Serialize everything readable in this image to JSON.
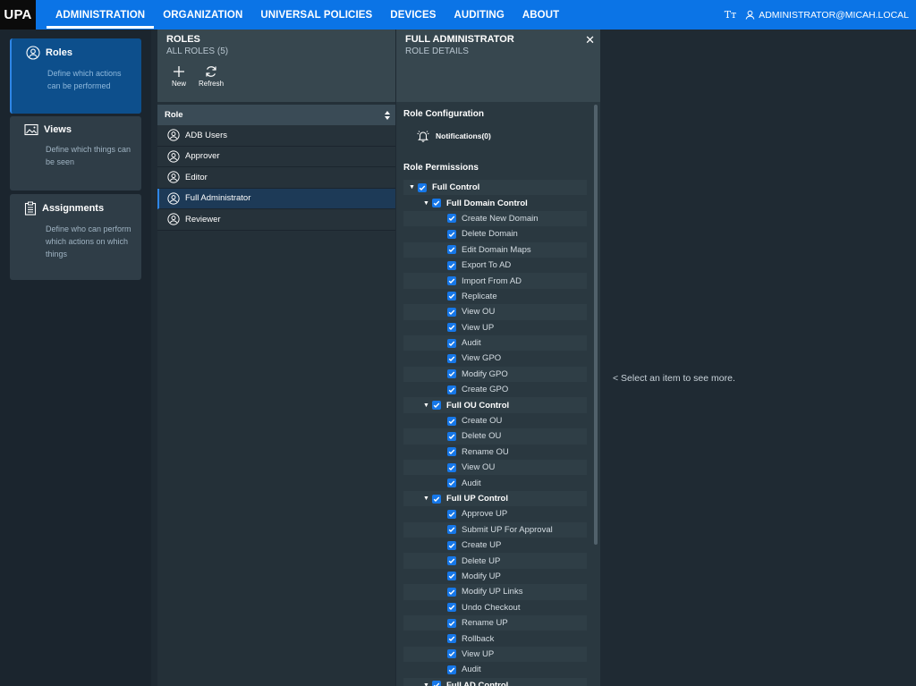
{
  "app": {
    "logo": "UPA"
  },
  "nav": [
    {
      "label": "ADMINISTRATION",
      "active": true
    },
    {
      "label": "ORGANIZATION",
      "active": false
    },
    {
      "label": "UNIVERSAL POLICIES",
      "active": false
    },
    {
      "label": "DEVICES",
      "active": false
    },
    {
      "label": "AUDITING",
      "active": false
    },
    {
      "label": "ABOUT",
      "active": false
    }
  ],
  "top_right": {
    "font_icon": "Tт",
    "user": "ADMINISTRATOR@MICAH.LOCAL"
  },
  "sidebar": [
    {
      "title": "Roles",
      "desc": "Define which actions can be performed",
      "icon": "user-circle-icon",
      "active": true
    },
    {
      "title": "Views",
      "desc": "Define which things can be seen",
      "icon": "image-icon",
      "active": false
    },
    {
      "title": "Assignments",
      "desc": "Define who can perform which actions on which things",
      "icon": "clipboard-icon",
      "active": false
    }
  ],
  "roles_panel": {
    "title": "ROLES",
    "subtitle": "ALL ROLES (5)",
    "new_label": "New",
    "refresh_label": "Refresh",
    "column": "Role",
    "items": [
      "ADB Users",
      "Approver",
      "Editor",
      "Full Administrator",
      "Reviewer"
    ],
    "selected_index": 3
  },
  "details": {
    "title": "FULL ADMINISTRATOR",
    "subtitle": "ROLE DETAILS",
    "config_heading": "Role Configuration",
    "notifications": "Notifications(0)",
    "permissions_heading": "Role Permissions",
    "tree": [
      {
        "level": 0,
        "label": "Full Control",
        "expanded": true
      },
      {
        "level": 1,
        "label": "Full Domain Control",
        "expanded": true
      },
      {
        "level": 2,
        "label": "Create New Domain"
      },
      {
        "level": 2,
        "label": "Delete Domain"
      },
      {
        "level": 2,
        "label": "Edit Domain Maps"
      },
      {
        "level": 2,
        "label": "Export To AD"
      },
      {
        "level": 2,
        "label": "Import From AD"
      },
      {
        "level": 2,
        "label": "Replicate"
      },
      {
        "level": 2,
        "label": "View OU"
      },
      {
        "level": 2,
        "label": "View UP"
      },
      {
        "level": 2,
        "label": "Audit"
      },
      {
        "level": 2,
        "label": "View GPO"
      },
      {
        "level": 2,
        "label": "Modify GPO"
      },
      {
        "level": 2,
        "label": "Create GPO"
      },
      {
        "level": 1,
        "label": "Full OU Control",
        "expanded": true
      },
      {
        "level": 2,
        "label": "Create OU"
      },
      {
        "level": 2,
        "label": "Delete OU"
      },
      {
        "level": 2,
        "label": "Rename OU"
      },
      {
        "level": 2,
        "label": "View OU"
      },
      {
        "level": 2,
        "label": "Audit"
      },
      {
        "level": 1,
        "label": "Full UP Control",
        "expanded": true
      },
      {
        "level": 2,
        "label": "Approve UP"
      },
      {
        "level": 2,
        "label": "Submit UP For Approval"
      },
      {
        "level": 2,
        "label": "Create UP"
      },
      {
        "level": 2,
        "label": "Delete UP"
      },
      {
        "level": 2,
        "label": "Modify UP"
      },
      {
        "level": 2,
        "label": "Modify UP Links"
      },
      {
        "level": 2,
        "label": "Undo Checkout"
      },
      {
        "level": 2,
        "label": "Rename UP"
      },
      {
        "level": 2,
        "label": "Rollback"
      },
      {
        "level": 2,
        "label": "View UP"
      },
      {
        "level": 2,
        "label": "Audit"
      },
      {
        "level": 1,
        "label": "Full AD Control",
        "expanded": true
      }
    ]
  },
  "empty_message": "< Select an item to see more."
}
